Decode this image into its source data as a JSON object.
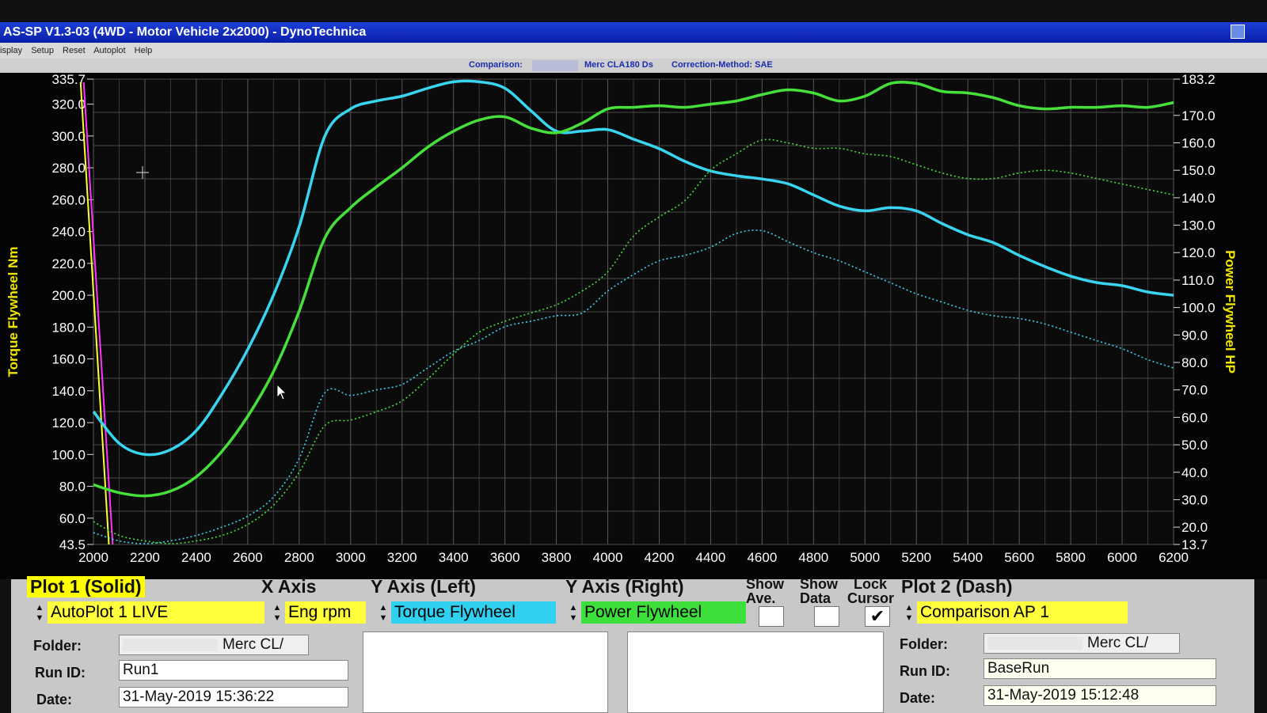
{
  "window": {
    "title": "AS-SP V1.3-03  (4WD - Motor Vehicle 2x2000) - DynoTechnica",
    "menu": [
      "isplay",
      "Setup",
      "Reset",
      "Autoplot",
      "Help"
    ]
  },
  "infobar": {
    "comparison_label": "Comparison:",
    "vehicle": "Merc CLA180 Ds",
    "correction": "Correction-Method: SAE"
  },
  "chart_data": {
    "type": "line",
    "xlabel": "",
    "ylabel_left": "Torque Flywheel Nm",
    "ylabel_right": "Power Flywheel HP",
    "x_ticks": [
      2000,
      2200,
      2400,
      2600,
      2800,
      3000,
      3200,
      3400,
      3600,
      3800,
      4000,
      4200,
      4400,
      4600,
      4800,
      5000,
      5200,
      5400,
      5600,
      5800,
      6000,
      6200
    ],
    "y_left_ticks": [
      "335.7",
      "320.0",
      "300.0",
      "280.0",
      "260.0",
      "240.0",
      "220.0",
      "200.0",
      "180.0",
      "160.0",
      "140.0",
      "120.0",
      "100.0",
      "80.0",
      "60.0",
      "43.5"
    ],
    "y_right_ticks": [
      "183.2",
      "170.0",
      "160.0",
      "150.0",
      "140.0",
      "130.0",
      "120.0",
      "110.0",
      "100.0",
      "90.0",
      "80.0",
      "70.0",
      "60.0",
      "50.0",
      "40.0",
      "30.0",
      "20.0",
      "13.7"
    ],
    "xlim": [
      2000,
      6200
    ],
    "ylim_left": [
      43.5,
      335.7
    ],
    "ylim_right": [
      13.7,
      183.2
    ],
    "grid": true,
    "colors": {
      "torque": "#38d4f0",
      "power": "#46e03a",
      "marker_yellow": "#ffff33",
      "marker_magenta": "#ff33ff",
      "label_yellow": "#f2e600"
    },
    "series": [
      {
        "id": "torque_run1",
        "axis": "left",
        "style": "solid",
        "x": [
          2000,
          2100,
          2200,
          2300,
          2400,
          2500,
          2600,
          2700,
          2800,
          2900,
          3000,
          3100,
          3200,
          3300,
          3400,
          3500,
          3600,
          3700,
          3800,
          3900,
          4000,
          4100,
          4200,
          4300,
          4400,
          4500,
          4600,
          4700,
          4800,
          4900,
          5000,
          5100,
          5200,
          5300,
          5400,
          5500,
          5600,
          5700,
          5800,
          5900,
          6000,
          6100,
          6200
        ],
        "y": [
          127,
          107,
          100,
          103,
          115,
          138,
          166,
          200,
          243,
          300,
          317,
          322,
          325,
          330,
          334,
          334,
          330,
          316,
          303,
          303,
          304,
          298,
          292,
          284,
          278,
          275,
          273,
          270,
          263,
          256,
          253,
          255,
          253,
          245,
          238,
          233,
          225,
          218,
          212,
          208,
          206,
          202,
          200
        ]
      },
      {
        "id": "torque_comparison",
        "axis": "left",
        "style": "solid",
        "x": [
          2000,
          2100,
          2200,
          2300,
          2400,
          2500,
          2600,
          2700,
          2800,
          2900,
          3000,
          3100,
          3200,
          3300,
          3400,
          3500,
          3600,
          3700,
          3800,
          3900,
          4000,
          4100,
          4200,
          4300,
          4400,
          4500,
          4600,
          4700,
          4800,
          4900,
          5000,
          5100,
          5200,
          5300,
          5400,
          5500,
          5600,
          5700,
          5800,
          5900,
          6000,
          6100,
          6200
        ],
        "y": [
          81,
          76,
          74,
          77,
          86,
          102,
          124,
          152,
          190,
          236,
          255,
          268,
          280,
          293,
          303,
          310,
          312,
          305,
          302,
          308,
          317,
          318,
          319,
          318,
          320,
          322,
          326,
          329,
          327,
          322,
          325,
          333,
          333,
          328,
          327,
          324,
          319,
          317,
          318,
          318,
          319,
          318,
          321
        ]
      },
      {
        "id": "power_run1",
        "axis": "right",
        "style": "dash",
        "x": [
          2000,
          2100,
          2200,
          2300,
          2400,
          2500,
          2600,
          2700,
          2800,
          2900,
          3000,
          3100,
          3200,
          3300,
          3400,
          3500,
          3600,
          3700,
          3800,
          3900,
          4000,
          4100,
          4200,
          4300,
          4400,
          4500,
          4600,
          4700,
          4800,
          4900,
          5000,
          5100,
          5200,
          5300,
          5400,
          5500,
          5600,
          5700,
          5800,
          5900,
          6000,
          6100,
          6200
        ],
        "y": [
          18,
          15,
          14,
          15,
          17,
          20,
          24,
          31,
          45,
          69,
          68,
          70,
          72,
          78,
          84,
          88,
          93,
          95,
          97,
          98,
          106,
          112,
          117,
          119,
          122,
          127,
          128,
          124,
          120,
          117,
          113,
          109,
          105,
          102,
          99,
          97,
          96,
          94,
          91,
          88,
          85,
          81,
          78
        ]
      },
      {
        "id": "power_comparison",
        "axis": "right",
        "style": "dash",
        "x": [
          2000,
          2100,
          2200,
          2300,
          2400,
          2500,
          2600,
          2700,
          2800,
          2900,
          3000,
          3100,
          3200,
          3300,
          3400,
          3500,
          3600,
          3700,
          3800,
          3900,
          4000,
          4100,
          4200,
          4300,
          4400,
          4500,
          4600,
          4700,
          4800,
          4900,
          5000,
          5100,
          5200,
          5300,
          5400,
          5500,
          5600,
          5700,
          5800,
          5900,
          6000,
          6100,
          6200
        ],
        "y": [
          22,
          17,
          15,
          14,
          15,
          17,
          21,
          28,
          40,
          57,
          59,
          62,
          66,
          74,
          83,
          91,
          95,
          98,
          101,
          106,
          113,
          126,
          133,
          139,
          150,
          156,
          161,
          160,
          158,
          158,
          156,
          155,
          152,
          149,
          147,
          147,
          149,
          150,
          149,
          147,
          145,
          143,
          141
        ]
      }
    ]
  },
  "panel": {
    "plot1_title": "Plot 1 (Solid)",
    "plot1_value": "AutoPlot 1 LIVE",
    "x_axis_title": "X Axis",
    "x_axis_value": "Eng rpm",
    "y_left_title": "Y Axis (Left)",
    "y_left_value": "Torque Flywheel",
    "y_right_title": "Y Axis (Right)",
    "y_right_value": "Power Flywheel",
    "show_ave_1": "Show",
    "show_ave_2": "Ave.",
    "show_data_1": "Show",
    "show_data_2": "Data",
    "lock_cursor_1": "Lock",
    "lock_cursor_2": "Cursor",
    "lock_cursor_checked": "✔",
    "plot2_title": "Plot 2 (Dash)",
    "plot2_value": "Comparison AP 1",
    "folder_label": "Folder:",
    "run_id_label": "Run ID:",
    "date_label": "Date:",
    "left_folder": "Merc CL/",
    "left_run_id": "Run1",
    "left_date": "31-May-2019  15:36:22",
    "right_folder": "Merc CL/",
    "right_run_id": "BaseRun",
    "right_date": "31-May-2019  15:12:48"
  }
}
